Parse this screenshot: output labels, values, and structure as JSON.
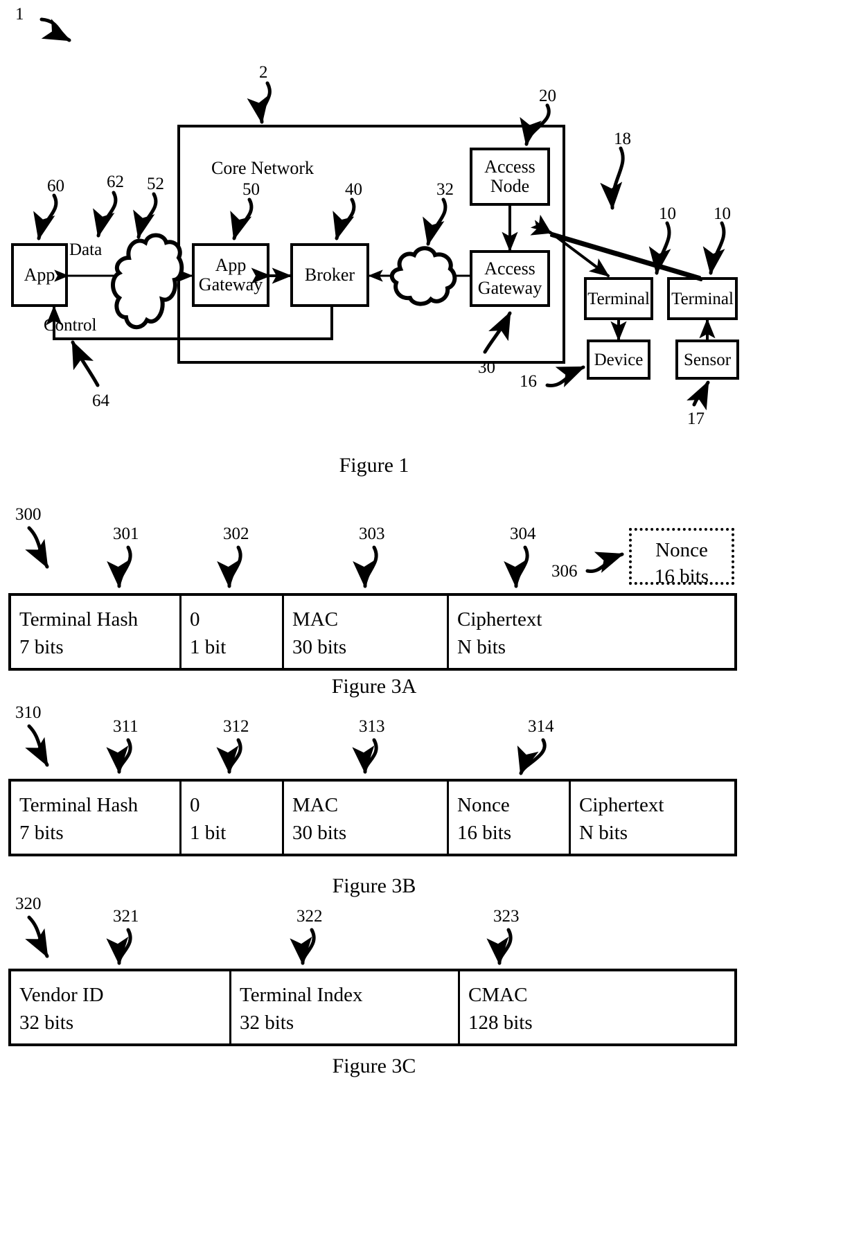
{
  "figure1": {
    "caption": "Figure 1",
    "system_ref": "1",
    "core_network_title": "Core Network",
    "core_network_ref": "2",
    "nodes": [
      {
        "id": "app",
        "label": "App",
        "ref": "60"
      },
      {
        "id": "app-gateway",
        "label": "App Gateway",
        "ref": "50"
      },
      {
        "id": "broker",
        "label": "Broker",
        "ref": "40"
      },
      {
        "id": "access-gateway",
        "label": "Access Gateway",
        "ref": "30"
      },
      {
        "id": "access-node",
        "label": "Access Node",
        "ref": "20"
      },
      {
        "id": "terminal-1",
        "label": "Terminal",
        "ref": "10"
      },
      {
        "id": "terminal-2",
        "label": "Terminal",
        "ref": "10"
      },
      {
        "id": "device",
        "label": "Device",
        "ref": "16"
      },
      {
        "id": "sensor",
        "label": "Sensor",
        "ref": "17"
      }
    ],
    "link_labels": [
      {
        "id": "data",
        "label": "Data",
        "ref": "62"
      },
      {
        "id": "control",
        "label": "Control",
        "ref": "64"
      }
    ],
    "cloud_left_ref": "52",
    "cloud_right_ref": "32",
    "air_interface_ref": "18"
  },
  "figure3a": {
    "caption": "Figure 3A",
    "packet_ref": "300",
    "field_refs": [
      "301",
      "302",
      "303",
      "304"
    ],
    "fields": [
      {
        "name": "Terminal Hash",
        "size": "7 bits"
      },
      {
        "name": "0",
        "size": "1 bit"
      },
      {
        "name": "MAC",
        "size": "30 bits"
      },
      {
        "name": "Ciphertext",
        "size": "N bits"
      }
    ],
    "detached": {
      "ref": "306",
      "name": "Nonce",
      "size": "16 bits"
    }
  },
  "figure3b": {
    "caption": "Figure 3B",
    "packet_ref": "310",
    "field_refs": [
      "311",
      "312",
      "313",
      "314"
    ],
    "fields": [
      {
        "name": "Terminal Hash",
        "size": "7 bits"
      },
      {
        "name": "0",
        "size": "1 bit"
      },
      {
        "name": "MAC",
        "size": "30 bits"
      },
      {
        "name": "Nonce",
        "size": "16 bits"
      },
      {
        "name": "Ciphertext",
        "size": "N bits"
      }
    ]
  },
  "figure3c": {
    "caption": "Figure 3C",
    "packet_ref": "320",
    "field_refs": [
      "321",
      "322",
      "323"
    ],
    "fields": [
      {
        "name": "Vendor ID",
        "size": "32 bits"
      },
      {
        "name": "Terminal Index",
        "size": "32 bits"
      },
      {
        "name": "CMAC",
        "size": "128 bits"
      }
    ]
  }
}
